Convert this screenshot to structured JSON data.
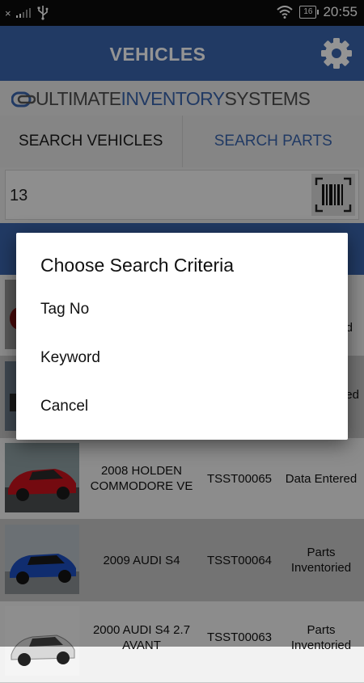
{
  "status_bar": {
    "time": "20:55",
    "battery": "16",
    "carrier_symbol": "×"
  },
  "app_bar": {
    "title": "VEHICLES"
  },
  "logo": {
    "part1": "ULTIMATE",
    "part2": "INVENTORY",
    "part3": "SYSTEMS"
  },
  "tabs": [
    {
      "label": "SEARCH VEHICLES"
    },
    {
      "label": "SEARCH PARTS"
    }
  ],
  "search": {
    "value": "13"
  },
  "vehicles": [
    {
      "name": "",
      "stock_no": "",
      "status": ""
    },
    {
      "name": "",
      "stock_no": "",
      "status": ""
    },
    {
      "name": "2008 HOLDEN COMMODORE VE",
      "stock_no": "TSST00065",
      "status": "Data Entered",
      "car_color": "#c8121c"
    },
    {
      "name": "2009 AUDI S4",
      "stock_no": "TSST00064",
      "status": "Parts Inventoried",
      "car_color": "#1d4fbf"
    },
    {
      "name": "2000 AUDI S4 2.7 AVANT",
      "stock_no": "TSST00063",
      "status": "Parts Inventoried",
      "car_color": "#d9d9d9"
    }
  ],
  "behind_dialog": {
    "row1_status_fragment": "ed",
    "row2_status_fragment": "ered"
  },
  "dialog": {
    "title": "Choose Search Criteria",
    "options": [
      {
        "label": "Tag No"
      },
      {
        "label": "Keyword"
      },
      {
        "label": "Cancel"
      }
    ]
  },
  "icons": {
    "settings": "gear-icon",
    "barcode": "barcode-scan-icon",
    "wifi": "wifi-icon",
    "usb": "usb-icon",
    "signal": "signal-icon"
  },
  "colors": {
    "primary": "#3a64ac",
    "status_bar": "#0c0c0c",
    "row_even": "#f2f2f2",
    "row_odd": "#c7c7c7"
  }
}
